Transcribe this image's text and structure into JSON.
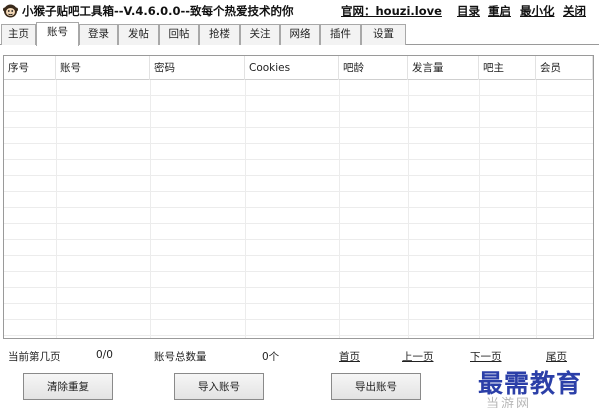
{
  "window": {
    "title": "小猴子贴吧工具箱--V.4.6.0.0--致每个热爱技术的你",
    "site": "官网：houzi.love",
    "links": [
      "目录",
      "重启",
      "最小化",
      "关闭"
    ]
  },
  "tabs": [
    {
      "label": "主页",
      "active": false
    },
    {
      "label": "账号",
      "active": true
    },
    {
      "label": "登录",
      "active": false
    },
    {
      "label": "发帖",
      "active": false
    },
    {
      "label": "回帖",
      "active": false
    },
    {
      "label": "抢楼",
      "active": false
    },
    {
      "label": "关注",
      "active": false
    },
    {
      "label": "网络",
      "active": false
    },
    {
      "label": "插件",
      "active": false
    },
    {
      "label": "设置",
      "active": false
    }
  ],
  "table": {
    "columns": [
      "序号",
      "账号",
      "密码",
      "Cookies",
      "吧龄",
      "发言量",
      "吧主",
      "会员"
    ],
    "rows": []
  },
  "status": {
    "current_page_label": "当前第几页",
    "current_page_value": "0/0",
    "total_label": "账号总数量",
    "total_value": "0个"
  },
  "pager": {
    "first": "首页",
    "prev": "上一页",
    "next": "下一页",
    "last": "尾页"
  },
  "buttons": {
    "dedupe": "清除重复",
    "import": "导入账号",
    "export": "导出账号"
  },
  "watermark": {
    "text": "最需教育",
    "faint": "当游网"
  },
  "colors": {
    "watermark": "#2b3fa8",
    "border": "#9a9a9a"
  }
}
